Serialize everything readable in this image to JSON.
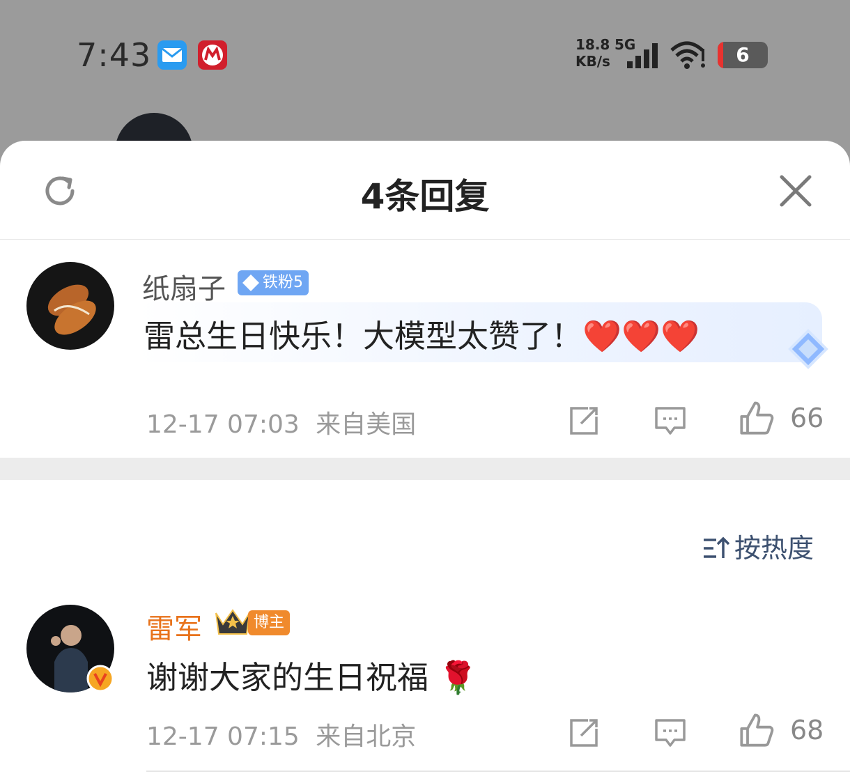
{
  "status_bar": {
    "time": "7:43",
    "net_speed_value": "18.8",
    "net_speed_unit": "KB/s",
    "network_type": "5G",
    "battery_level": "6",
    "icons": [
      "mail-icon",
      "bank-app-icon",
      "signal-icon",
      "wifi-icon",
      "battery-icon"
    ]
  },
  "sheet": {
    "title": "4条回复",
    "refresh_icon": "refresh-icon",
    "close_icon": "close-icon"
  },
  "root_comment": {
    "username": "纸扇子",
    "badge": "铁粉5",
    "text": "雷总生日快乐！大模型太赞了！❤️❤️❤️",
    "date": "12-17 07:03",
    "location": "来自美国",
    "likes": "66"
  },
  "sort": {
    "label": "按热度"
  },
  "replies": [
    {
      "username": "雷军",
      "badge": "博主",
      "text": "谢谢大家的生日祝福 🌹",
      "date": "12-17 07:15",
      "location": "来自北京",
      "likes": "68"
    }
  ],
  "colors": {
    "overlay": "#9b9b9b",
    "sheet_bg": "#ffffff",
    "author_orange": "#e8731c",
    "badge_blue": "#6fa6f3",
    "sort_text": "#3d5170",
    "meta_text": "#9a9a9a"
  }
}
